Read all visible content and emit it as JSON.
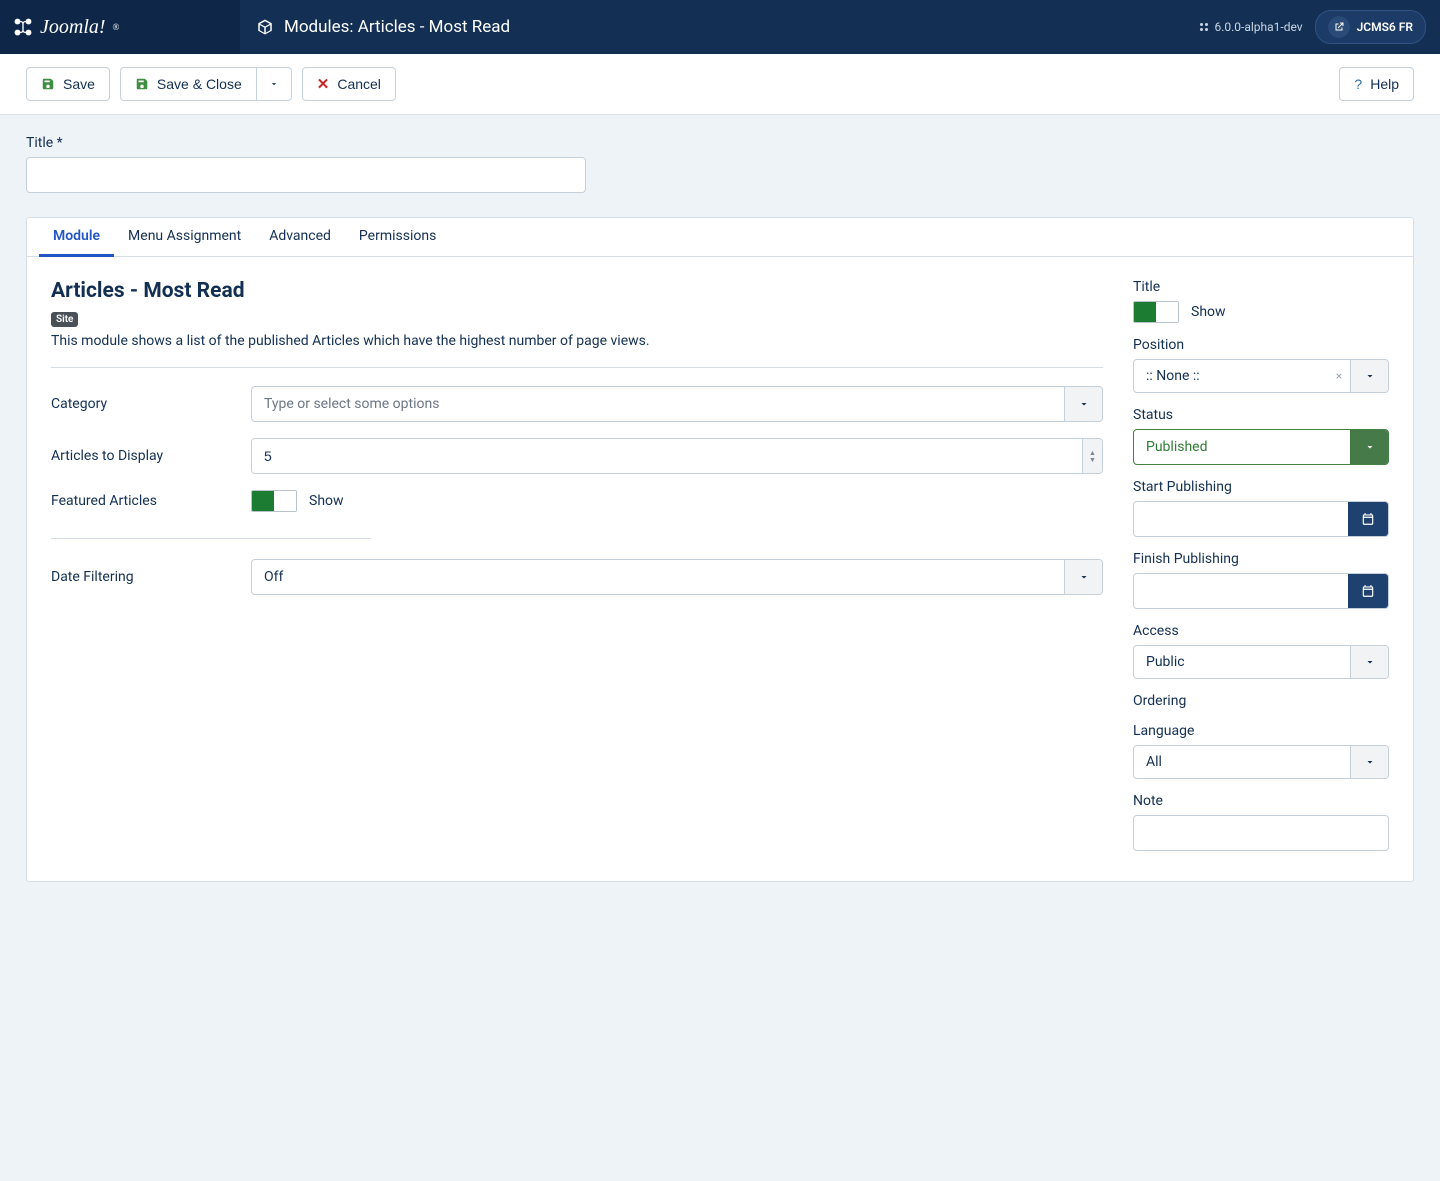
{
  "header": {
    "brand": "Joomla!",
    "page_title": "Modules: Articles - Most Read",
    "version": "6.0.0-alpha1-dev",
    "site_name": "JCMS6 FR"
  },
  "toolbar": {
    "save": "Save",
    "save_close": "Save & Close",
    "cancel": "Cancel",
    "help": "Help"
  },
  "form": {
    "title_label": "Title *",
    "title_value": ""
  },
  "tabs": [
    {
      "id": "module",
      "label": "Module",
      "active": true
    },
    {
      "id": "menu-assign",
      "label": "Menu Assignment",
      "active": false
    },
    {
      "id": "advanced",
      "label": "Advanced",
      "active": false
    },
    {
      "id": "permissions",
      "label": "Permissions",
      "active": false
    }
  ],
  "module": {
    "heading": "Articles - Most Read",
    "badge": "Site",
    "description": "This module shows a list of the published Articles which have the highest number of page views.",
    "fields": {
      "category_label": "Category",
      "category_placeholder": "Type or select some options",
      "articles_label": "Articles to Display",
      "articles_value": "5",
      "featured_label": "Featured Articles",
      "featured_toggle_text": "Show",
      "filter_label": "Date Filtering",
      "filter_value": "Off"
    }
  },
  "side": {
    "title_label": "Title",
    "title_toggle_text": "Show",
    "position_label": "Position",
    "position_value": ":: None ::",
    "status_label": "Status",
    "status_value": "Published",
    "start_pub_label": "Start Publishing",
    "start_pub_value": "",
    "finish_pub_label": "Finish Publishing",
    "finish_pub_value": "",
    "access_label": "Access",
    "access_value": "Public",
    "ordering_label": "Ordering",
    "language_label": "Language",
    "language_value": "All",
    "note_label": "Note",
    "note_value": ""
  }
}
